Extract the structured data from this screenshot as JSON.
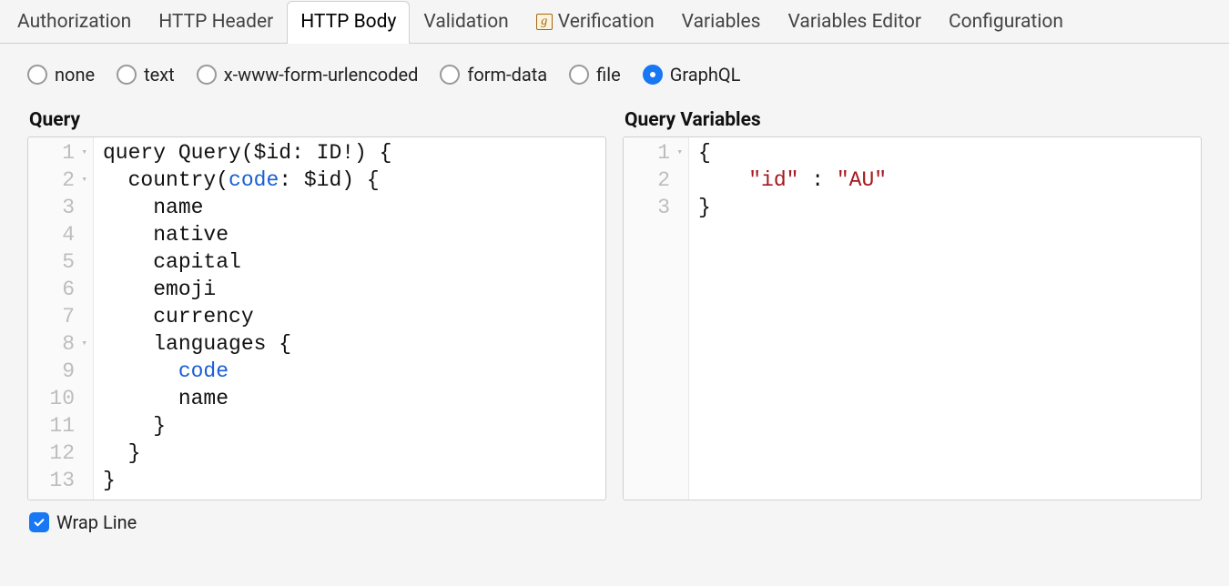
{
  "tabs": [
    {
      "label": "Authorization"
    },
    {
      "label": "HTTP Header"
    },
    {
      "label": "HTTP Body",
      "active": true
    },
    {
      "label": "Validation"
    },
    {
      "label": "Verification",
      "icon": "g"
    },
    {
      "label": "Variables"
    },
    {
      "label": "Variables Editor"
    },
    {
      "label": "Configuration"
    }
  ],
  "body_types": [
    {
      "label": "none",
      "selected": false
    },
    {
      "label": "text",
      "selected": false
    },
    {
      "label": "x-www-form-urlencoded",
      "selected": false
    },
    {
      "label": "form-data",
      "selected": false
    },
    {
      "label": "file",
      "selected": false
    },
    {
      "label": "GraphQL",
      "selected": true
    }
  ],
  "editors": {
    "query": {
      "title": "Query",
      "lines": [
        {
          "n": 1,
          "fold": true,
          "segments": [
            {
              "t": "query Query($id: ID!) {"
            }
          ]
        },
        {
          "n": 2,
          "fold": true,
          "segments": [
            {
              "t": "  country("
            },
            {
              "t": "code",
              "c": "kw"
            },
            {
              "t": ": $id) {"
            }
          ]
        },
        {
          "n": 3,
          "segments": [
            {
              "t": "    name"
            }
          ]
        },
        {
          "n": 4,
          "segments": [
            {
              "t": "    native"
            }
          ]
        },
        {
          "n": 5,
          "segments": [
            {
              "t": "    capital"
            }
          ]
        },
        {
          "n": 6,
          "segments": [
            {
              "t": "    emoji"
            }
          ]
        },
        {
          "n": 7,
          "segments": [
            {
              "t": "    currency"
            }
          ]
        },
        {
          "n": 8,
          "fold": true,
          "segments": [
            {
              "t": "    languages {"
            }
          ]
        },
        {
          "n": 9,
          "segments": [
            {
              "t": "      "
            },
            {
              "t": "code",
              "c": "kw"
            }
          ]
        },
        {
          "n": 10,
          "segments": [
            {
              "t": "      name"
            }
          ]
        },
        {
          "n": 11,
          "segments": [
            {
              "t": "    }"
            }
          ]
        },
        {
          "n": 12,
          "segments": [
            {
              "t": "  }"
            }
          ]
        },
        {
          "n": 13,
          "segments": [
            {
              "t": "}"
            }
          ]
        }
      ]
    },
    "vars": {
      "title": "Query Variables",
      "lines": [
        {
          "n": 1,
          "fold": true,
          "segments": [
            {
              "t": "{"
            }
          ]
        },
        {
          "n": 2,
          "segments": [
            {
              "t": "    "
            },
            {
              "t": "\"id\"",
              "c": "str"
            },
            {
              "t": " : "
            },
            {
              "t": "\"AU\"",
              "c": "str"
            }
          ]
        },
        {
          "n": 3,
          "segments": [
            {
              "t": "}"
            }
          ]
        }
      ]
    }
  },
  "footer": {
    "wrap_label": "Wrap Line",
    "wrap_checked": true
  }
}
